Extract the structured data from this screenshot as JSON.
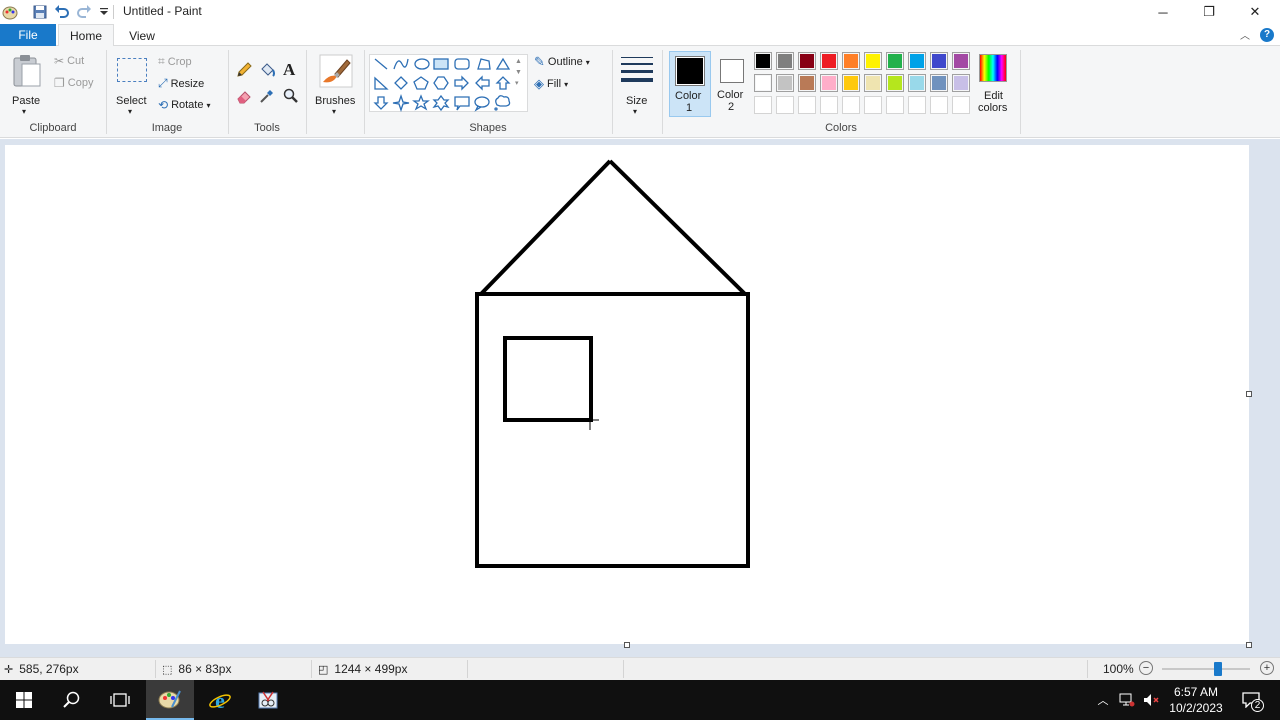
{
  "window": {
    "title": "Untitled - Paint",
    "minimize": "─",
    "restore": "❐",
    "close": "✕"
  },
  "tabs": [
    {
      "label": "File"
    },
    {
      "label": "Home"
    },
    {
      "label": "View"
    }
  ],
  "ribbon": {
    "clipboard": {
      "label": "Clipboard",
      "paste": "Paste",
      "cut": "Cut",
      "copy": "Copy"
    },
    "image": {
      "label": "Image",
      "select": "Select",
      "crop": "Crop",
      "resize": "Resize",
      "rotate": "Rotate"
    },
    "tools": {
      "label": "Tools",
      "text_glyph": "A"
    },
    "brushes": {
      "label": "Brushes"
    },
    "shapes": {
      "label": "Shapes",
      "outline": "Outline",
      "fill": "Fill"
    },
    "size": {
      "label": "Size"
    },
    "colors": {
      "label": "Colors",
      "color1_line1": "Color",
      "color1_line2": "1",
      "color2_line1": "Color",
      "color2_line2": "2",
      "edit_line1": "Edit",
      "edit_line2": "colors",
      "color1_value": "#000000",
      "color2_value": "#ffffff",
      "palette_row1": [
        "#000000",
        "#7f7f7f",
        "#880015",
        "#ed1c24",
        "#ff7f27",
        "#fff200",
        "#22b14c",
        "#00a2e8",
        "#3f48cc",
        "#a349a4"
      ],
      "palette_row2": [
        "#ffffff",
        "#c3c3c3",
        "#b97a57",
        "#ffaec9",
        "#ffc90e",
        "#efe4b0",
        "#b5e61d",
        "#99d9ea",
        "#7092be",
        "#c8bfe7"
      ],
      "palette_row3": [
        "",
        "",
        "",
        "",
        "",
        "",
        "",
        "",
        "",
        ""
      ]
    }
  },
  "status": {
    "cursor_pos": "585, 276px",
    "selection_size": "86 × 83px",
    "canvas_size": "1244 × 499px",
    "zoom": "100%",
    "zoom_fraction": 0.65
  },
  "taskbar": {
    "time": "6:57 AM",
    "date": "10/2/2023",
    "notifications": "2"
  }
}
